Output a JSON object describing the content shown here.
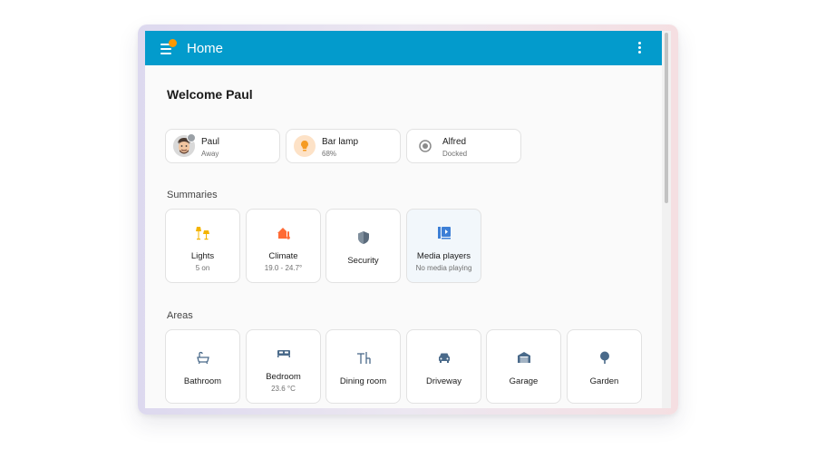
{
  "header": {
    "title": "Home",
    "has_notification": true
  },
  "welcome": "Welcome Paul",
  "entities": [
    {
      "name": "Paul",
      "state": "Away",
      "icon": "avatar-icon"
    },
    {
      "name": "Bar lamp",
      "state": "68%",
      "icon": "lightbulb-icon"
    },
    {
      "name": "Alfred",
      "state": "Docked",
      "icon": "robot-vacuum-icon"
    }
  ],
  "summaries": {
    "heading": "Summaries",
    "items": [
      {
        "label": "Lights",
        "sub": "5 on",
        "icon": "floor-lamp-icon",
        "color": "#f4b400"
      },
      {
        "label": "Climate",
        "sub": "19.0 - 24.7°",
        "icon": "home-thermometer-icon",
        "color": "#ff6b35"
      },
      {
        "label": "Security",
        "sub": "",
        "icon": "shield-icon",
        "color": "#5b6b7c"
      },
      {
        "label": "Media players",
        "sub": "No media playing",
        "icon": "media-library-icon",
        "color": "#3d7fd6"
      }
    ]
  },
  "areas": {
    "heading": "Areas",
    "items": [
      {
        "label": "Bathroom",
        "sub": "",
        "icon": "bathtub-icon"
      },
      {
        "label": "Bedroom",
        "sub": "23.6 °C",
        "icon": "bed-icon"
      },
      {
        "label": "Dining room",
        "sub": "",
        "icon": "table-chair-icon"
      },
      {
        "label": "Driveway",
        "sub": "",
        "icon": "car-icon"
      },
      {
        "label": "Garage",
        "sub": "",
        "icon": "garage-icon"
      },
      {
        "label": "Garden",
        "sub": "",
        "icon": "tree-icon"
      }
    ]
  },
  "colors": {
    "header": "#039bcc",
    "notification": "#ff9800",
    "area_icon": "#4a6a8a"
  }
}
